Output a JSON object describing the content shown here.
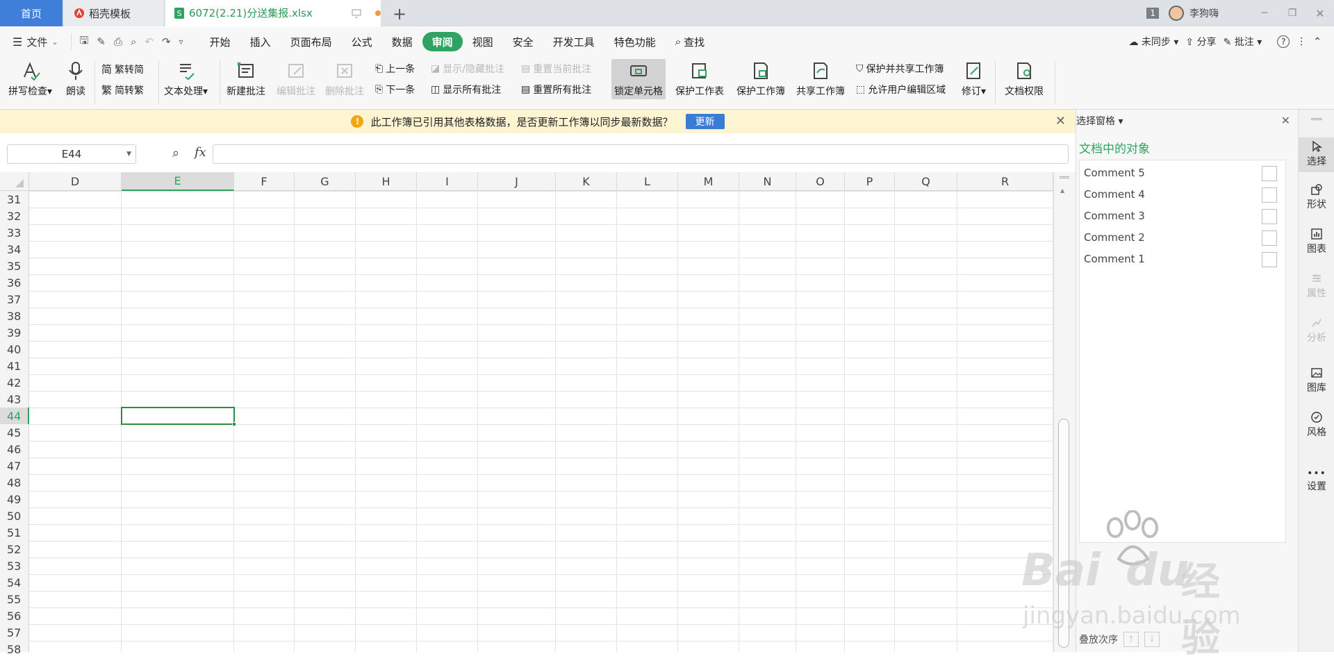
{
  "tabs": {
    "home": "首页",
    "templates": "稻壳模板",
    "file": "6072(2.21)分送集报.xlsx"
  },
  "window": {
    "badge": "1",
    "user": "李狗嗨"
  },
  "menu": {
    "file": "文件",
    "items": [
      "开始",
      "插入",
      "页面布局",
      "公式",
      "数据",
      "审阅",
      "视图",
      "安全",
      "开发工具",
      "特色功能"
    ],
    "search": "查找",
    "sync": "未同步",
    "share": "分享",
    "comment": "批注"
  },
  "ribbon": {
    "spell": "拼写检查",
    "read": "朗读",
    "trad": "繁转简",
    "simp": "简转繁",
    "textproc": "文本处理",
    "new_comment": "新建批注",
    "edit_comment": "编辑批注",
    "delete_comment": "删除批注",
    "prev": "上一条",
    "next": "下一条",
    "show_hide": "显示/隐藏批注",
    "show_all": "显示所有批注",
    "reset_current": "重置当前批注",
    "reset_all": "重置所有批注",
    "lock_cell": "锁定单元格",
    "protect_sheet": "保护工作表",
    "protect_book": "保护工作簿",
    "share_book": "共享工作簿",
    "protect_share": "保护并共享工作簿",
    "allow_edit": "允许用户编辑区域",
    "revise": "修订",
    "doc_rights": "文档权限"
  },
  "notice": {
    "text": "此工作簿已引用其他表格数据，是否更新工作簿以同步最新数据？",
    "button": "更新"
  },
  "formula": {
    "cell_ref": "E44",
    "fx": "fx",
    "value": ""
  },
  "columns": [
    "D",
    "E",
    "F",
    "G",
    "H",
    "I",
    "J",
    "K",
    "L",
    "M",
    "N",
    "O",
    "P",
    "Q",
    "R"
  ],
  "rows": [
    "31",
    "32",
    "33",
    "34",
    "35",
    "36",
    "37",
    "38",
    "39",
    "40",
    "41",
    "42",
    "43",
    "44",
    "45",
    "46",
    "47",
    "48",
    "49",
    "50",
    "51",
    "52",
    "53",
    "54",
    "55",
    "56",
    "57",
    "58"
  ],
  "selected_row": "44",
  "selection_pane": {
    "title": "选择窗格",
    "section": "文档中的对象",
    "objects": [
      "Comment 5",
      "Comment 4",
      "Comment 3",
      "Comment 2",
      "Comment 1"
    ],
    "stack_order": "叠放次序"
  },
  "sidebar": [
    "选择",
    "形状",
    "图表",
    "属性",
    "分析",
    "图库",
    "风格",
    "设置"
  ],
  "watermark": {
    "brand": "Bai",
    "brand2": "du",
    "cn": "经验",
    "url": "jingyan.baidu.com"
  },
  "colors": {
    "accent_green": "#2fa462",
    "tab_blue": "#3f7fd9",
    "notice_bg": "#fdf4d2",
    "update_btn": "#3a7bd5"
  }
}
